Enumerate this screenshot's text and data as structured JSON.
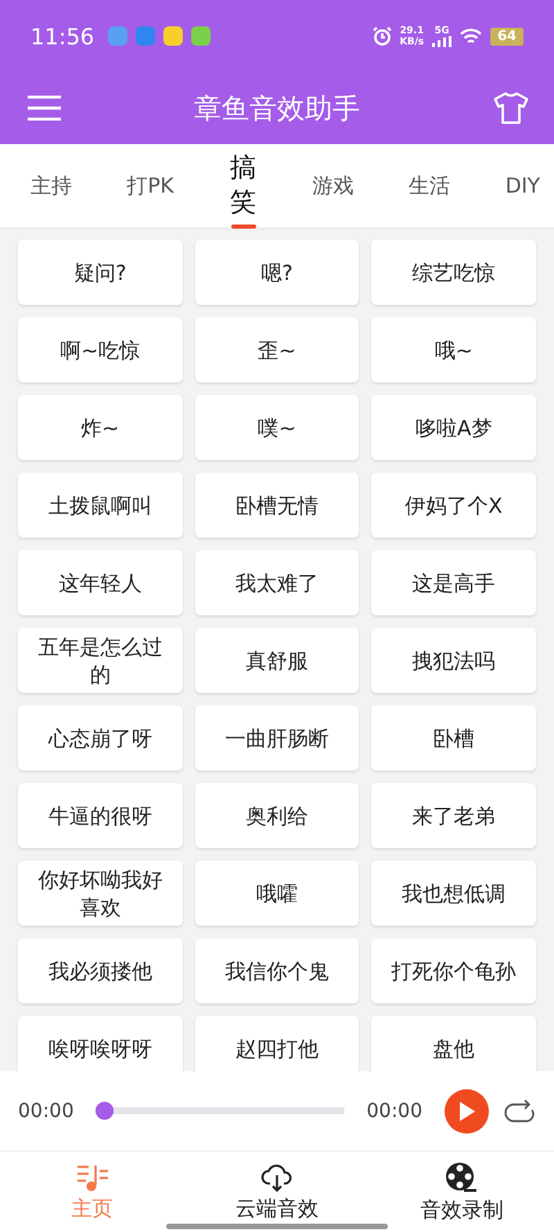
{
  "status_bar": {
    "time": "11:56",
    "speed": "29.1",
    "speed_unit": "KB/s",
    "network": "5G",
    "battery": "64"
  },
  "header": {
    "title": "章鱼音效助手"
  },
  "tabs": [
    {
      "label": "主持",
      "selected": false
    },
    {
      "label": "打PK",
      "selected": false
    },
    {
      "label": "搞笑",
      "selected": true
    },
    {
      "label": "游戏",
      "selected": false
    },
    {
      "label": "生活",
      "selected": false
    },
    {
      "label": "DIY",
      "selected": false
    }
  ],
  "sounds": [
    "疑问?",
    "嗯?",
    "综艺吃惊",
    "啊~吃惊",
    "歪~",
    "哦~",
    "炸~",
    "噗~",
    "哆啦A梦",
    "土拨鼠啊叫",
    "卧槽无情",
    "伊妈了个X",
    "这年轻人",
    "我太难了",
    "这是高手",
    "五年是怎么过的",
    "真舒服",
    "拽犯法吗",
    "心态崩了呀",
    "一曲肝肠断",
    "卧槽",
    "牛逼的很呀",
    "奥利给",
    "来了老弟",
    "你好坏呦我好喜欢",
    "哦嚯",
    "我也想低调",
    "我必须搂他",
    "我信你个鬼",
    "打死你个龟孙",
    "唉呀唉呀呀",
    "赵四打他",
    "盘他"
  ],
  "player": {
    "current_time": "00:00",
    "total_time": "00:00",
    "level": 0
  },
  "nav": [
    {
      "label": "主页",
      "selected": true,
      "kind": "music"
    },
    {
      "label": "云端音效",
      "selected": false,
      "kind": "cloud"
    },
    {
      "label": "音效录制",
      "selected": false,
      "kind": "film"
    }
  ]
}
